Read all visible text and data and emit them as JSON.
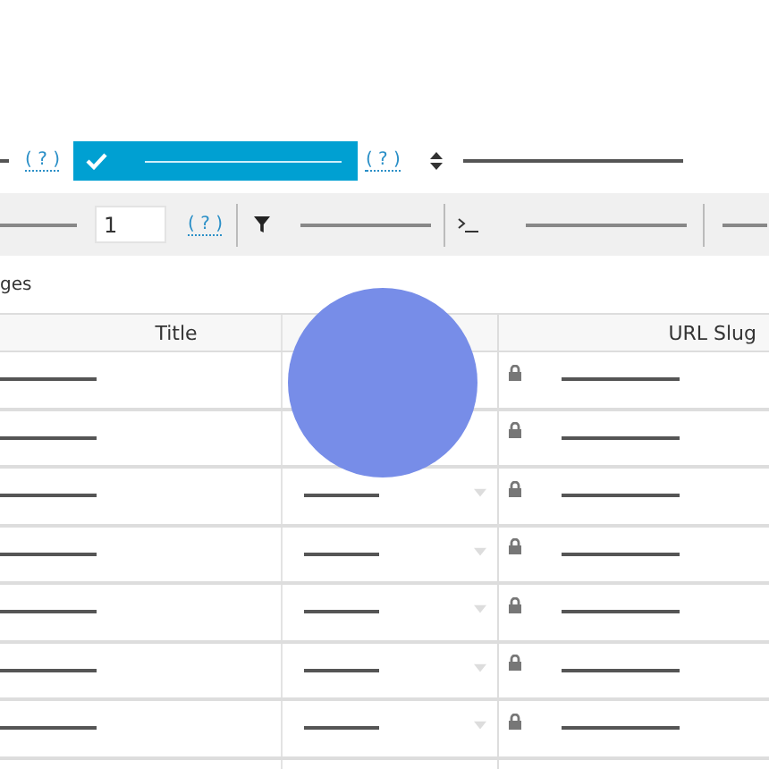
{
  "top_bar": {
    "help_links": [
      "( ? )",
      "( ? )"
    ],
    "toggle": {
      "checked": true
    }
  },
  "toolbar": {
    "page_input": {
      "value": "1"
    },
    "help_link": "( ? )"
  },
  "section_label": "ges",
  "table": {
    "columns": [
      "Title",
      "",
      "URL Slug"
    ],
    "rows": [
      {
        "category_visible": false,
        "locked": true
      },
      {
        "category_visible": false,
        "locked": true
      },
      {
        "category_visible": true,
        "locked": true
      },
      {
        "category_visible": true,
        "locked": true
      },
      {
        "category_visible": true,
        "locked": true
      },
      {
        "category_visible": true,
        "locked": true
      },
      {
        "category_visible": true,
        "locked": true
      }
    ]
  }
}
